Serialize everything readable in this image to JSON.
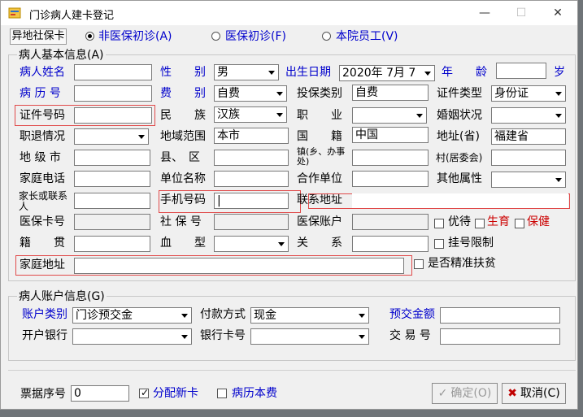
{
  "window": {
    "title": "门诊病人建卡登记",
    "minimize": "—",
    "maximize": "☐",
    "close": "✕"
  },
  "toolbar": {
    "remote_card": "异地社保卡",
    "visit_types": [
      {
        "label": "非医保初诊(A)",
        "selected": true
      },
      {
        "label": "医保初诊(F)",
        "selected": false
      },
      {
        "label": "本院员工(V)",
        "selected": false
      }
    ]
  },
  "basic": {
    "title": "病人基本信息(A)",
    "name_label": "病人姓名",
    "name_value": "",
    "gender_label": "性　　别",
    "gender_value": "男",
    "birth_label": "出生日期",
    "birth_value": "2020年 7月 7",
    "age_label": "年　　龄",
    "age_value": "",
    "age_unit": "岁",
    "record_no_label": "病 历 号",
    "record_no_value": "",
    "fee_type_label": "费　　别",
    "fee_type_value": "自费",
    "insure_type_label": "投保类别",
    "insure_type_value": "自费",
    "id_type_label": "证件类型",
    "id_type_value": "身份证",
    "id_no_label": "证件号码",
    "id_no_value": "",
    "ethnic_label": "民　　族",
    "ethnic_value": "汉族",
    "job_label": "职　　业",
    "job_value": "",
    "marital_label": "婚姻状况",
    "marital_value": "",
    "retire_label": "职退情况",
    "retire_value": "",
    "region_label": "地域范围",
    "region_value": "本市",
    "nation_label": "国　　籍",
    "nation_value": "中国",
    "province_label": "地址(省)",
    "province_value": "福建省",
    "city_label": "地 级 市",
    "city_value": "",
    "county_label": "县、　区",
    "county_value": "",
    "town_label": "镇(乡、办事处)",
    "town_value": "",
    "village_label": "村(居委会)",
    "village_value": "",
    "home_phone_label": "家庭电话",
    "home_phone_value": "",
    "work_unit_label": "单位名称",
    "work_unit_value": "",
    "coop_unit_label": "合作单位",
    "coop_unit_value": "",
    "other_attr_label": "其他属性",
    "other_attr_value": "",
    "contact_label": "家长或联系人",
    "contact_value": "",
    "mobile_label": "手机号码",
    "mobile_value": "|",
    "contact_addr_label": "联系地址",
    "contact_addr_value": "",
    "insure_card_label": "医保卡号",
    "insure_card_value": "",
    "social_no_label": "社 保 号",
    "social_no_value": "",
    "insure_acct_label": "医保账户",
    "insure_acct_value": "",
    "priority_label": "优待",
    "birth_chk_label": "生育",
    "health_chk_label": "保健",
    "origin_label": "籍　　贯",
    "origin_value": "",
    "blood_label": "血　　型",
    "blood_value": "",
    "relation_label": "关　　系",
    "relation_value": "",
    "reg_limit_label": "挂号限制",
    "home_addr_label": "家庭地址",
    "home_addr_value": "",
    "poverty_label": "是否精准扶贫"
  },
  "account": {
    "title": "病人账户信息(G)",
    "acct_type_label": "账户类别",
    "acct_type_value": "门诊预交金",
    "pay_method_label": "付款方式",
    "pay_method_value": "现金",
    "prepay_label": "预交金额",
    "prepay_value": "",
    "bank_label": "开户银行",
    "bank_value": "",
    "bank_card_label": "银行卡号",
    "bank_card_value": "",
    "trade_no_label": "交 易 号",
    "trade_no_value": ""
  },
  "footer": {
    "receipt_label": "票据序号",
    "receipt_value": "0",
    "new_card_label": "分配新卡",
    "new_card_checked": true,
    "record_fee_label": "病历本费",
    "record_fee_checked": false,
    "confirm_label": "确定(O)",
    "cancel_label": "取消(C)"
  }
}
